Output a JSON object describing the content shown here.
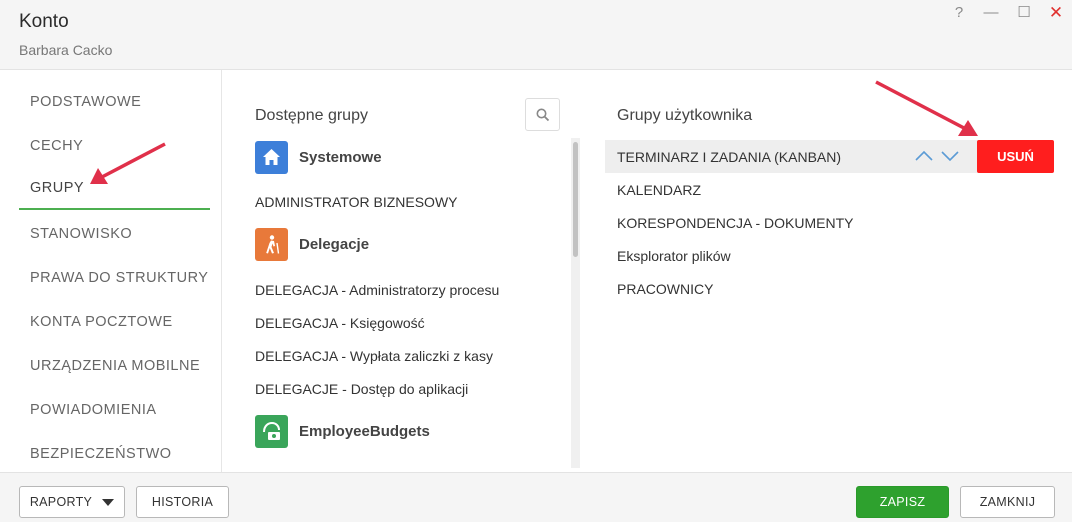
{
  "window": {
    "title": "Konto",
    "subtitle": "Barbara Cacko",
    "controls": {
      "help": "?",
      "minimize": "—",
      "maximize": "☐",
      "close": "✕"
    }
  },
  "nav": {
    "items": [
      {
        "label": "PODSTAWOWE"
      },
      {
        "label": "CECHY"
      },
      {
        "label": "GRUPY"
      },
      {
        "label": "STANOWISKO"
      },
      {
        "label": "PRAWA DO STRUKTURY"
      },
      {
        "label": "KONTA POCZTOWE"
      },
      {
        "label": "URZĄDZENIA MOBILNE"
      },
      {
        "label": "POWIADOMIENIA"
      },
      {
        "label": "BEZPIECZEŃSTWO"
      }
    ],
    "active": "GRUPY"
  },
  "available": {
    "title": "Dostępne grupy",
    "search_icon": "search-icon",
    "groups": [
      {
        "name": "Systemowe",
        "icon": "home-icon",
        "color": "#3d7fd9",
        "items": [
          "ADMINISTRATOR BIZNESOWY"
        ]
      },
      {
        "name": "Delegacje",
        "icon": "traveler-icon",
        "color": "#e8793a",
        "items": [
          "DELEGACJA - Administratorzy procesu",
          "DELEGACJA - Księgowość",
          "DELEGACJA - Wypłata zaliczki z kasy",
          "DELEGACJE - Dostęp do aplikacji"
        ]
      },
      {
        "name": "EmployeeBudgets",
        "icon": "money-icon",
        "color": "#3aa55a",
        "items": []
      }
    ]
  },
  "user_groups": {
    "title": "Grupy użytkownika",
    "items": [
      "TERMINARZ I ZADANIA (KANBAN)",
      "KALENDARZ",
      "KORESPONDENCJA - DOKUMENTY",
      "Eksplorator plików",
      "PRACOWNICY"
    ],
    "selected": "TERMINARZ I ZADANIA (KANBAN)",
    "remove_label": "USUŃ",
    "remove_color": "#ff1e1e"
  },
  "footer": {
    "reports_label": "RAPORTY",
    "history_label": "HISTORIA",
    "save_label": "ZAPISZ",
    "close_label": "ZAMKNIJ",
    "save_color": "#2ea12e"
  },
  "annotation_color": "#e0304a"
}
